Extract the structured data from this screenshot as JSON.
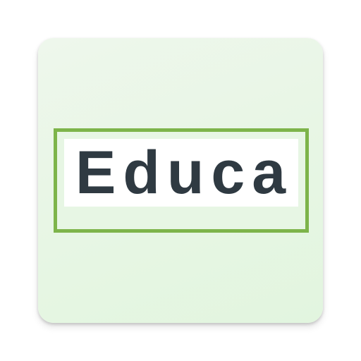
{
  "app_icon": {
    "logo_text": "Educa",
    "colors": {
      "background": "#e7f6e4",
      "frame": "#7db44a",
      "text": "#2f3a42",
      "inner": "#ffffff"
    }
  }
}
